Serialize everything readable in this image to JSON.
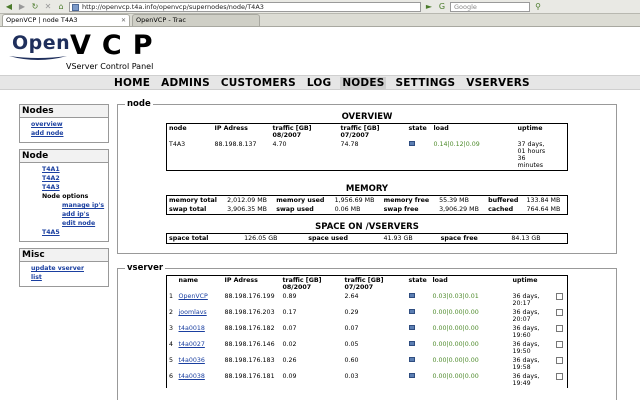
{
  "browser": {
    "url": "http://openvcp.t4a.info/openvcp/supernodes/node/T4A3",
    "search_placeholder": "Google",
    "tabs": [
      {
        "label": "OpenVCP | node T4A3"
      },
      {
        "label": "OpenVCP - Trac"
      }
    ]
  },
  "logo": {
    "open": "Open",
    "vcp": "VCP",
    "subtitle": "VServer Control Panel"
  },
  "nav": {
    "items": [
      "HOME",
      "ADMINS",
      "CUSTOMERS",
      "LOG",
      "NODES",
      "SETTINGS",
      "VSERVERS"
    ],
    "active": "NODES"
  },
  "sidebar": {
    "nodes_title": "Nodes",
    "overview": "overview",
    "add_node": "add node",
    "node_title": "Node",
    "t4a1": "T4A1",
    "t4a2": "T4A2",
    "t4a3": "T4A3",
    "node_options": "Node options",
    "manage_ips": "manage ip's",
    "add_ips": "add ip's",
    "edit_node": "edit node",
    "t4a5": "T4A5",
    "misc_title": "Misc",
    "update_line1": "update vserver",
    "update_line2": "list"
  },
  "node": {
    "legend": "node",
    "overview_title": "OVERVIEW",
    "overview": {
      "headers": {
        "node": "node",
        "ip": "IP Adress",
        "traffic1a": "traffic [GB]",
        "traffic1b": "08/2007",
        "traffic2a": "traffic [GB]",
        "traffic2b": "07/2007",
        "state": "state",
        "load": "load",
        "uptime": "uptime"
      },
      "row": {
        "node": "T4A3",
        "ip": "88.198.8.137",
        "traffic1": "4.70",
        "traffic2": "74.78",
        "load": "0.14|0.12|0.09",
        "uptime1": "37 days,",
        "uptime2": "01 hours",
        "uptime3": "36",
        "uptime4": "minutes"
      }
    },
    "memory_title": "MEMORY",
    "memory": {
      "mem_total_label": "memory total",
      "mem_total": "2,012.09 MB",
      "mem_used_label": "memory used",
      "mem_used": "1,956.69 MB",
      "mem_free_label": "memory free",
      "mem_free": "55.39 MB",
      "buffered_label": "buffered",
      "buffered": "133.84 MB",
      "swap_total_label": "swap total",
      "swap_total": "3,906.35 MB",
      "swap_used_label": "swap used",
      "swap_used": "0.06 MB",
      "swap_free_label": "swap free",
      "swap_free": "3,906.29 MB",
      "cached_label": "cached",
      "cached": "764.64 MB"
    },
    "space_title": "SPACE ON /VSERVERS",
    "space": {
      "total_label": "space total",
      "total": "126.05 GB",
      "used_label": "space used",
      "used": "41.93 GB",
      "free_label": "space free",
      "free": "84.13 GB"
    }
  },
  "vserver": {
    "legend": "vserver",
    "headers": {
      "name": "name",
      "ip": "IP Adress",
      "traffic1a": "traffic [GB]",
      "traffic1b": "08/2007",
      "traffic2a": "traffic [GB]",
      "traffic2b": "07/2007",
      "state": "state",
      "load": "load",
      "uptime": "uptime"
    },
    "rows": [
      {
        "n": "1",
        "name": "OpenVCP",
        "ip": "88.198.176.199",
        "t1": "0.89",
        "t2": "2.64",
        "load": "0.03|0.03|0.01",
        "up1": "36 days,",
        "up2": "20:17"
      },
      {
        "n": "2",
        "name": "joomlavs",
        "ip": "88.198.176.203",
        "t1": "0.17",
        "t2": "0.29",
        "load": "0.00|0.00|0.00",
        "up1": "36 days,",
        "up2": "20:07"
      },
      {
        "n": "3",
        "name": "t4a0018",
        "ip": "88.198.176.182",
        "t1": "0.07",
        "t2": "0.07",
        "load": "0.00|0.00|0.00",
        "up1": "36 days,",
        "up2": "19:60"
      },
      {
        "n": "4",
        "name": "t4a0027",
        "ip": "88.198.176.146",
        "t1": "0.02",
        "t2": "0.05",
        "load": "0.00|0.00|0.00",
        "up1": "36 days,",
        "up2": "19:50"
      },
      {
        "n": "5",
        "name": "t4a0036",
        "ip": "88.198.176.183",
        "t1": "0.26",
        "t2": "0.60",
        "load": "0.00|0.00|0.00",
        "up1": "36 days,",
        "up2": "19:58"
      },
      {
        "n": "6",
        "name": "t4a0038",
        "ip": "88.198.176.181",
        "t1": "0.09",
        "t2": "0.03",
        "load": "0.00|0.00|0.00",
        "up1": "36 days,",
        "up2": "19:49"
      }
    ]
  }
}
